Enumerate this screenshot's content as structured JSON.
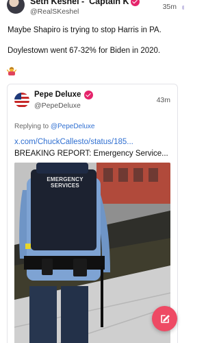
{
  "post": {
    "author_name": "Seth Keshel -  Captain K",
    "author_handle": "@RealSKeshel",
    "time": "35m",
    "line1": "Maybe Shapiro is trying to stop Harris in PA.",
    "line2": "Doylestown went 67-32% for Biden in 2020.",
    "emoji_name": "person-shrugging-emoji"
  },
  "quote": {
    "author_name": "Pepe Deluxe",
    "author_handle": "@PepeDeluxe",
    "time": "43m",
    "replying_prefix": "Replying to ",
    "replying_handle": "@PepeDeluxe",
    "link_text": "x.com/ChuckCallesto/status/185...",
    "text": "BREAKING REPORT: Emergency Service...",
    "media": {
      "vest_text": "EMERGENCY SERVICES",
      "description_icon": "video-thumbnail"
    }
  },
  "fab": {
    "icon": "compose-icon",
    "color": "#ee4a64"
  },
  "colors": {
    "verified": "#e5246b",
    "link": "#2f6fd1"
  }
}
